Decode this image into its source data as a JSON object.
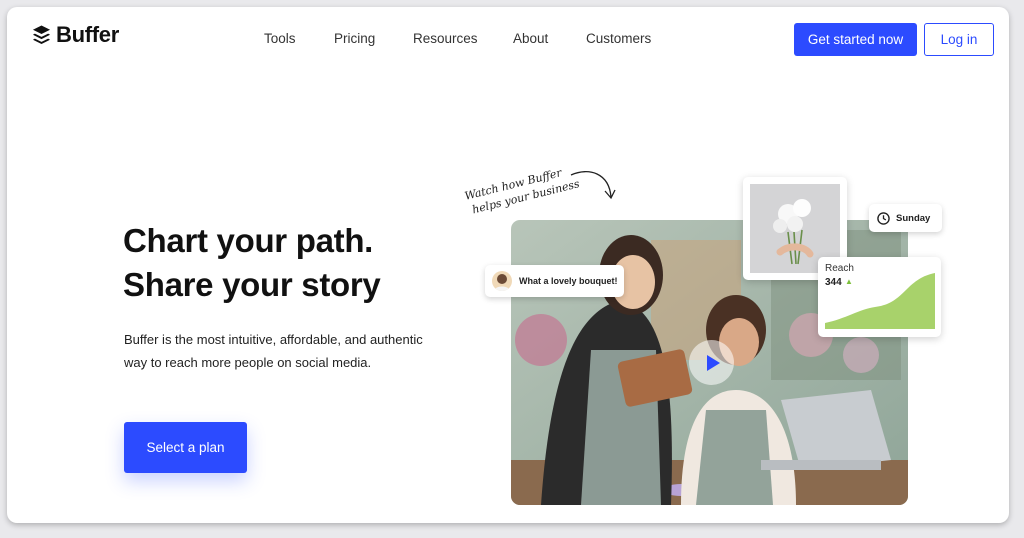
{
  "header": {
    "logo_text": "Buffer",
    "nav": [
      "Tools",
      "Pricing",
      "Resources",
      "About",
      "Customers"
    ],
    "get_started": "Get started now",
    "login": "Log in"
  },
  "hero": {
    "headline_line1": "Chart your path.",
    "headline_line2": "Share your story",
    "subtext": "Buffer is the most intuitive, affordable, and authentic way to reach more people on social media.",
    "cta": "Select a plan"
  },
  "media": {
    "handwritten_line1": "Watch how Buffer",
    "handwritten_line2": "helps your business",
    "comment": "What a lovely bouquet!",
    "schedule_day": "Sunday",
    "reach_label": "Reach",
    "reach_value": "344"
  },
  "colors": {
    "brand_blue": "#2c4bff",
    "chart_green": "#a8d26b"
  }
}
